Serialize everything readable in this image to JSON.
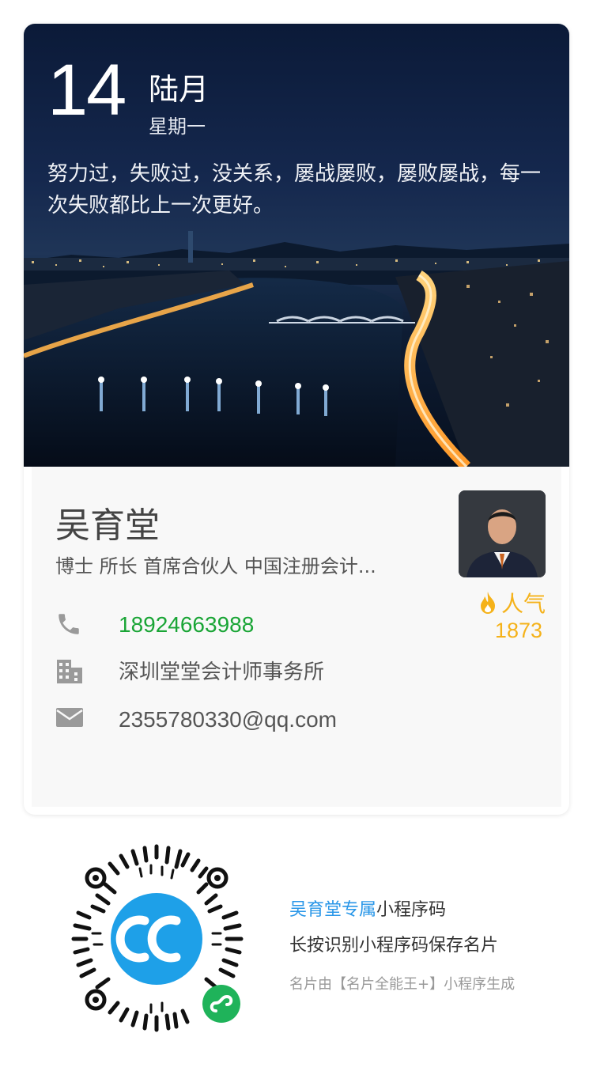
{
  "date": {
    "day": "14",
    "month": "陆月",
    "weekday": "星期一"
  },
  "quote": "努力过，失败过，没关系，屡战屡败，屡败屡战，每一次失败都比上一次更好。",
  "profile": {
    "name": "吴育堂",
    "title": "博士 所长 首席合伙人 中国注册会计...",
    "phone": "18924663988",
    "company": "深圳堂堂会计师事务所",
    "email": "2355780330@qq.com"
  },
  "popularity": {
    "label": "人气",
    "count": "1873"
  },
  "footer": {
    "line1_accent": "吴育堂专属",
    "line1_rest": "小程序码",
    "line2": "长按识别小程序码保存名片",
    "line3": "名片由【名片全能王+】小程序生成"
  },
  "colors": {
    "phone": "#1aa536",
    "popularity": "#f5b21a",
    "accent": "#2896e8",
    "qr_center": "#1ea0e8",
    "mini_program_badge": "#1fb35a"
  },
  "icons": [
    "phone-icon",
    "building-icon",
    "mail-icon",
    "flame-icon",
    "mini-program-icon"
  ]
}
